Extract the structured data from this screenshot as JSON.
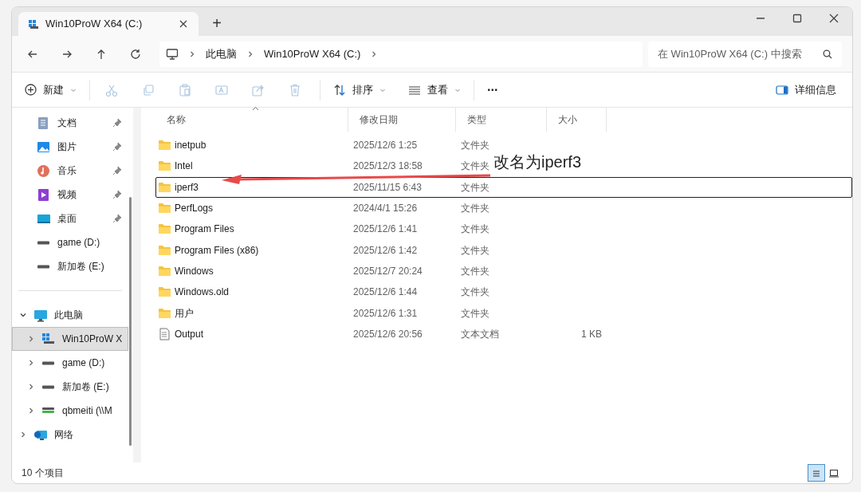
{
  "window": {
    "tabs": [
      {
        "label": "Win10ProW X64 (C:)",
        "selected": true
      }
    ],
    "new_tab": "+"
  },
  "address": {
    "breadcrumb": [
      "此电脑",
      "Win10ProW X64 (C:)"
    ],
    "search_placeholder": "在 Win10ProW X64 (C:) 中搜索"
  },
  "toolbar": {
    "new": "新建",
    "actions": [
      {
        "kind": "cut",
        "disabled": true
      },
      {
        "kind": "copy",
        "disabled": true
      },
      {
        "kind": "paste",
        "disabled": true
      },
      {
        "kind": "rename",
        "disabled": true
      },
      {
        "kind": "share",
        "disabled": true
      },
      {
        "kind": "delete",
        "disabled": true
      }
    ],
    "sort": "排序",
    "view": "查看",
    "more": "···",
    "details": "详细信息"
  },
  "sidebar": {
    "quick": [
      {
        "label": "文档",
        "kind": "documents",
        "pinned": true
      },
      {
        "label": "图片",
        "kind": "pictures",
        "pinned": true
      },
      {
        "label": "音乐",
        "kind": "music",
        "pinned": true
      },
      {
        "label": "视频",
        "kind": "videos",
        "pinned": true
      },
      {
        "label": "桌面",
        "kind": "desktop",
        "pinned": true
      },
      {
        "label": "game (D:)",
        "kind": "drive",
        "pinned": false
      },
      {
        "label": "新加卷 (E:)",
        "kind": "drive",
        "pinned": false
      }
    ],
    "tree": [
      {
        "label": "此电脑",
        "kind": "pc",
        "expanded": true,
        "selected": false,
        "children": [
          {
            "label": "Win10ProW X",
            "kind": "system-drive",
            "expanded": false,
            "selected": true
          },
          {
            "label": "game (D:)",
            "kind": "drive",
            "expanded": false,
            "selected": false
          },
          {
            "label": "新加卷 (E:)",
            "kind": "drive",
            "expanded": false,
            "selected": false
          },
          {
            "label": "qbmeiti (\\\\M",
            "kind": "network-drive",
            "expanded": false,
            "selected": false
          }
        ]
      },
      {
        "label": "网络",
        "kind": "network",
        "expanded": false,
        "selected": false
      }
    ]
  },
  "table": {
    "columns": [
      {
        "label": "名称",
        "sorted": true
      },
      {
        "label": "修改日期",
        "sorted": false
      },
      {
        "label": "类型",
        "sorted": false
      },
      {
        "label": "大小",
        "sorted": false
      }
    ],
    "rows": [
      {
        "kind": "folder",
        "name": "inetpub",
        "date": "2025/12/6 1:25",
        "type": "文件夹",
        "annotated": false
      },
      {
        "kind": "folder",
        "name": "Intel",
        "date": "2025/12/3 18:58",
        "type": "文件夹",
        "annotated": false
      },
      {
        "kind": "folder",
        "name": "iperf3",
        "date": "2025/11/15 6:43",
        "type": "文件夹",
        "annotated": true
      },
      {
        "kind": "folder",
        "name": "PerfLogs",
        "date": "2024/4/1 15:26",
        "type": "文件夹",
        "annotated": false
      },
      {
        "kind": "folder",
        "name": "Program Files",
        "date": "2025/12/6 1:41",
        "type": "文件夹",
        "annotated": false
      },
      {
        "kind": "folder",
        "name": "Program Files (x86)",
        "date": "2025/12/6 1:42",
        "type": "文件夹",
        "annotated": false
      },
      {
        "kind": "folder",
        "name": "Windows",
        "date": "2025/12/7 20:24",
        "type": "文件夹",
        "annotated": false
      },
      {
        "kind": "folder",
        "name": "Windows.old",
        "date": "2025/12/6 1:44",
        "type": "文件夹",
        "annotated": false
      },
      {
        "kind": "folder",
        "name": "用户",
        "date": "2025/12/6 1:31",
        "type": "文件夹",
        "annotated": false
      },
      {
        "kind": "file",
        "name": "Output",
        "date": "2025/12/6 20:56",
        "type": "文本文档",
        "size": "1 KB",
        "annotated": false
      }
    ]
  },
  "annotation": {
    "text": "改名为iperf3"
  },
  "status_bar": {
    "count": "10 个项目",
    "views": [
      {
        "kind": "details",
        "selected": true
      },
      {
        "kind": "tiles",
        "selected": false
      }
    ]
  }
}
